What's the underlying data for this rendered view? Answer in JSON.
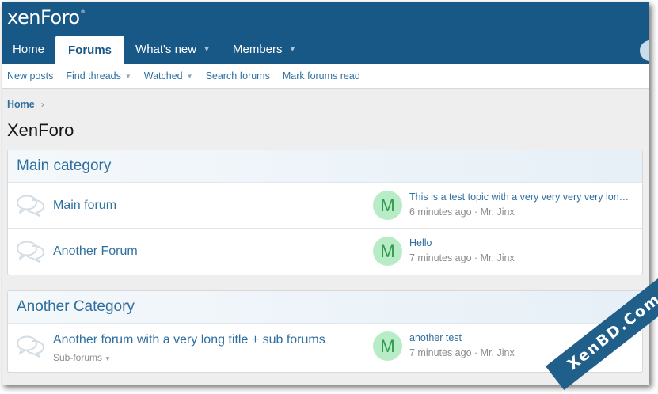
{
  "header": {
    "logo_text": "xenForo",
    "logo_mark": "®"
  },
  "nav": {
    "tabs": [
      {
        "label": "Home",
        "has_caret": false
      },
      {
        "label": "Forums",
        "has_caret": false,
        "active": true
      },
      {
        "label": "What's new",
        "has_caret": true
      },
      {
        "label": "Members",
        "has_caret": true
      }
    ]
  },
  "subnav": {
    "new_posts": "New posts",
    "find_threads": "Find threads",
    "watched": "Watched",
    "search_forums": "Search forums",
    "mark_read": "Mark forums read"
  },
  "breadcrumb": {
    "home": "Home"
  },
  "page_title": "XenForo",
  "categories": [
    {
      "title": "Main category",
      "nodes": [
        {
          "title": "Main forum",
          "avatar_letter": "M",
          "last_title": "This is a test topic with a very very very very long title",
          "last_time": "6 minutes ago",
          "last_user": "Mr. Jinx"
        },
        {
          "title": "Another Forum",
          "avatar_letter": "M",
          "last_title": "Hello",
          "last_time": "7 minutes ago",
          "last_user": "Mr. Jinx"
        }
      ]
    },
    {
      "title": "Another Category",
      "nodes": [
        {
          "title": "Another forum with a very long title + sub forums",
          "sub_label": "Sub-forums",
          "avatar_letter": "M",
          "last_title": "another test",
          "last_time": "7 minutes ago",
          "last_user": "Mr. Jinx"
        }
      ]
    }
  ],
  "separator": " · ",
  "watermark": "XenBD.Com",
  "colors": {
    "header": "#185886",
    "link": "#2f6f9f",
    "avatar_bg": "#b8ecc6",
    "avatar_fg": "#2f9a50"
  }
}
